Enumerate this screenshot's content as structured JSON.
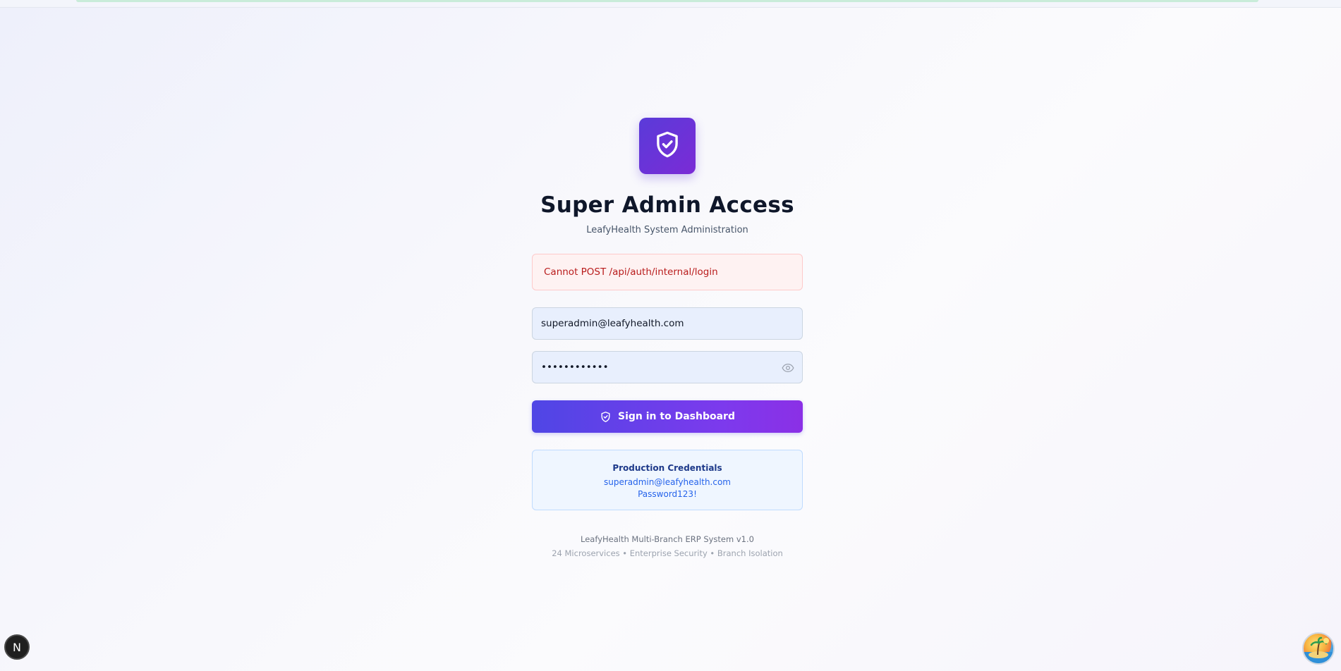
{
  "header": {
    "title": "Super Admin Access",
    "subtitle": "LeafyHealth System Administration",
    "logo_icon": "shield-check-icon"
  },
  "alert": {
    "message": "Cannot POST /api/auth/internal/login",
    "type": "error"
  },
  "form": {
    "email_value": "superadmin@leafyhealth.com",
    "password_mask": "••••••••••••",
    "toggle_icon": "eye-icon",
    "submit_label": "Sign in to Dashboard",
    "submit_icon": "shield-check-icon"
  },
  "credentials": {
    "title": "Production Credentials",
    "email": "superadmin@leafyhealth.com",
    "password": "Password123!"
  },
  "footer": {
    "line1": "LeafyHealth Multi-Branch ERP System v1.0",
    "line2": "24 Microservices • Enterprise Security • Branch Isolation"
  },
  "overlays": {
    "dev_badge_letter": "N",
    "dev_badge_icon": "nextjs-icon",
    "assistant_icon": "island-avatar-icon"
  },
  "colors": {
    "accent_start": "#4f46e5",
    "accent_end": "#8b30e6",
    "error_text": "#b91c1c",
    "info_text": "#2563eb"
  }
}
